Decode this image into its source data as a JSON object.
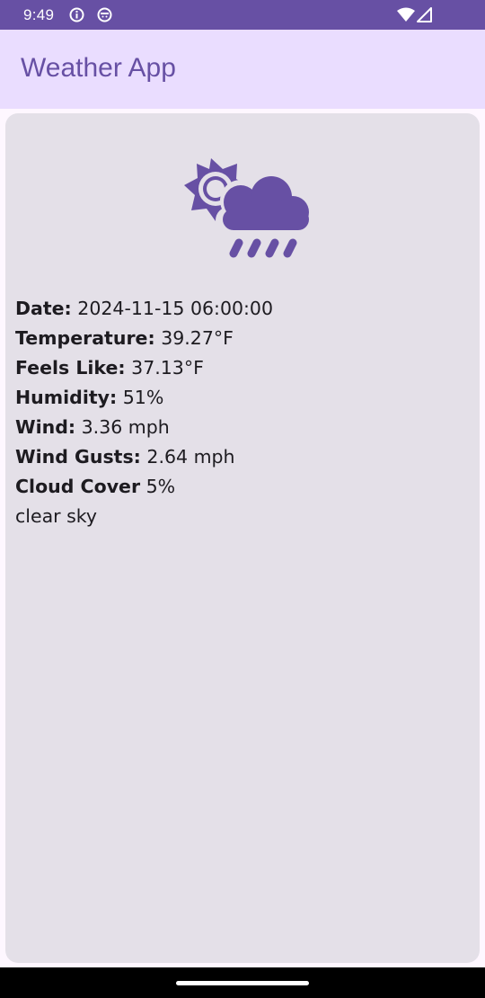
{
  "status_bar": {
    "time": "9:49",
    "left_icons": [
      "info-icon",
      "android-icon"
    ],
    "right_icons": [
      "wifi-icon",
      "signal-icon"
    ]
  },
  "app_bar": {
    "title": "Weather App"
  },
  "weather": {
    "icon": "cloud-sun-rain-icon",
    "rows": [
      {
        "label": "Date:",
        "value": "2024-11-15 06:00:00"
      },
      {
        "label": "Temperature:",
        "value": "39.27°F"
      },
      {
        "label": "Feels Like:",
        "value": "37.13°F"
      },
      {
        "label": "Humidity:",
        "value": "51%"
      },
      {
        "label": "Wind:",
        "value": "3.36 mph"
      },
      {
        "label": "Wind Gusts:",
        "value": "2.64 mph"
      },
      {
        "label": "Cloud Cover",
        "value": "5%"
      }
    ],
    "description": "clear sky"
  },
  "colors": {
    "primary": "#6750a4",
    "app_bar_bg": "#eaddff",
    "card_bg": "#e4e0e8"
  }
}
